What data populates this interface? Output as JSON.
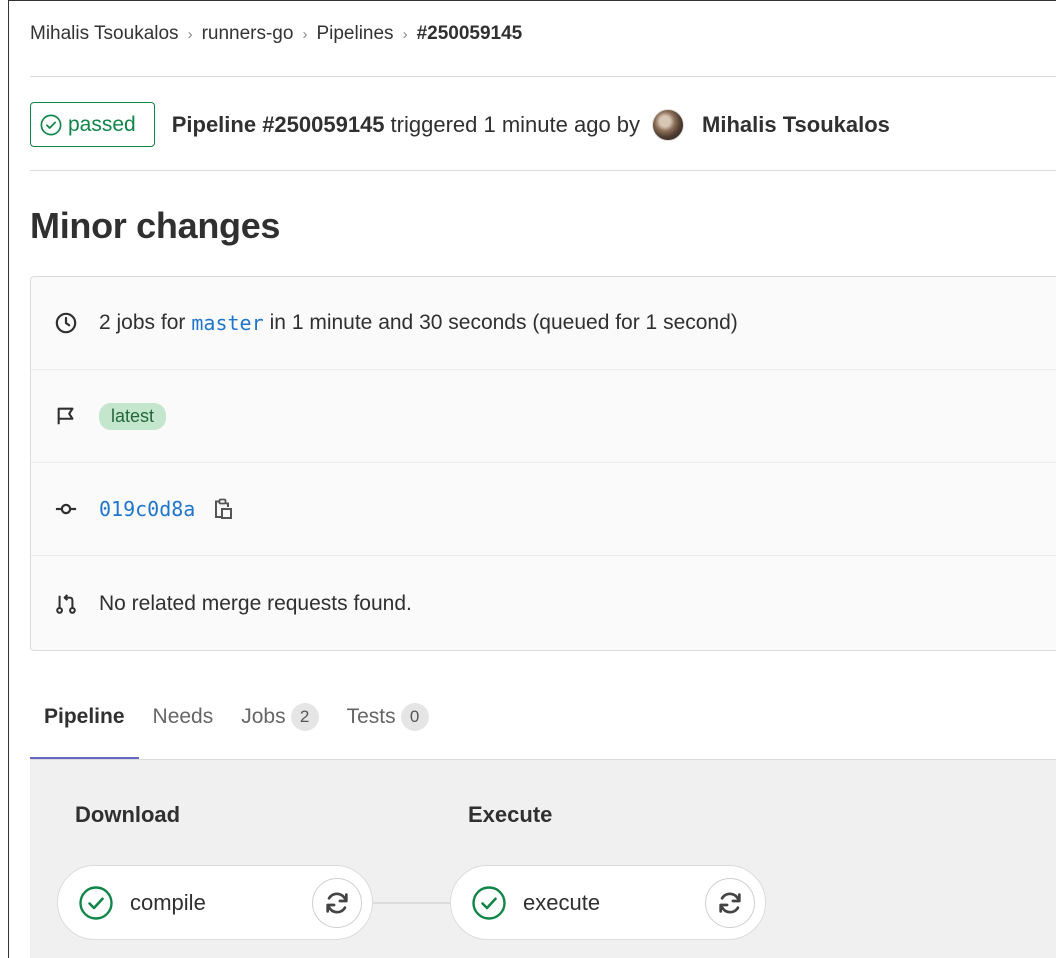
{
  "breadcrumb": {
    "items": [
      "Mihalis Tsoukalos",
      "runners-go",
      "Pipelines"
    ],
    "current": "#250059145"
  },
  "header": {
    "status": "passed",
    "pipeline_label": "Pipeline #250059145",
    "triggered_text": "triggered 1 minute ago by",
    "author": "Mihalis Tsoukalos"
  },
  "commit_title": "Minor changes",
  "info": {
    "jobs_prefix": "2 jobs for",
    "branch": "master",
    "jobs_suffix": "in 1 minute and 30 seconds (queued for 1 second)",
    "tag": "latest",
    "commit_sha": "019c0d8a",
    "merge_requests_text": "No related merge requests found."
  },
  "tabs": [
    {
      "label": "Pipeline",
      "active": true
    },
    {
      "label": "Needs"
    },
    {
      "label": "Jobs",
      "count": "2"
    },
    {
      "label": "Tests",
      "count": "0"
    }
  ],
  "stages": [
    {
      "title": "Download",
      "job": "compile",
      "status": "success"
    },
    {
      "title": "Execute",
      "job": "execute",
      "status": "success"
    }
  ],
  "colors": {
    "success": "#108548",
    "link": "#1f75cb",
    "active_tab": "#6666c4",
    "latest_badge_bg": "#c3e6cd"
  },
  "icons": {
    "status": "check-circle-icon",
    "duration": "clock-icon",
    "tag": "flag-icon",
    "commit": "commit-icon",
    "copy": "clipboard-icon",
    "merge_request": "merge-request-icon",
    "retry": "retry-icon"
  }
}
